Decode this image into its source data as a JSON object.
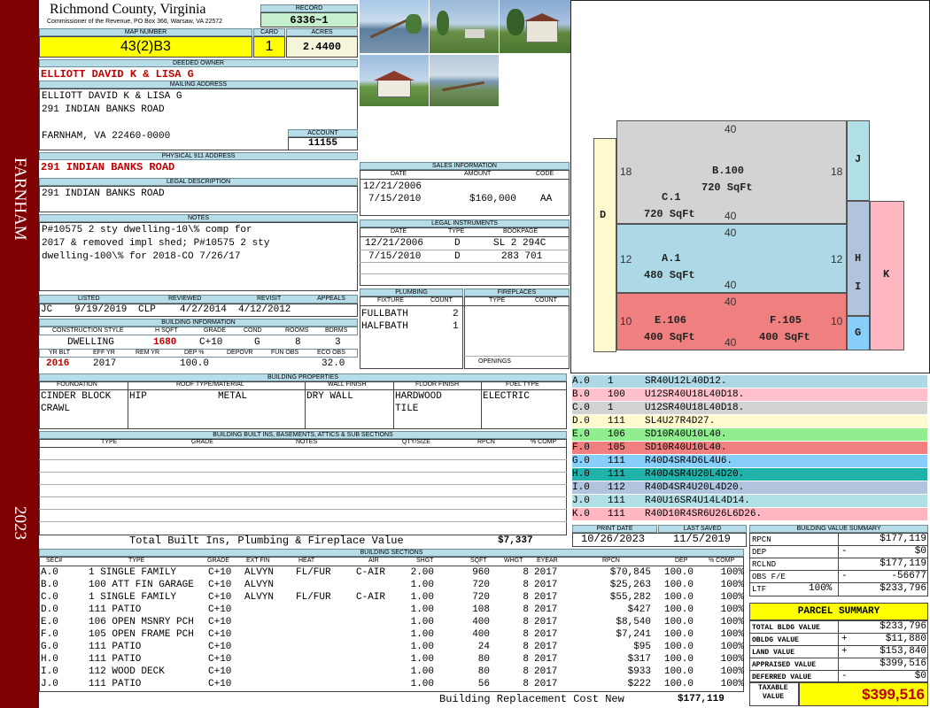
{
  "side": {
    "top": "FARNHAM",
    "bottom": "2023"
  },
  "header": {
    "county": "Richmond County, Virginia",
    "sub": "Commissioner of the Revenue, PO Box 366, Warsaw, VA 22572",
    "record_label": "RECORD",
    "record": "6336~1",
    "map_label": "MAP NUMBER",
    "map": "43(2)B3",
    "card_label": "CARD",
    "card": "1",
    "acres_label": "ACRES",
    "acres": "2.4400"
  },
  "owner": {
    "label": "DEEDED OWNER",
    "name": "ELLIOTT DAVID K & LISA G",
    "mail_label": "MAILING ADDRESS",
    "mail1": "ELLIOTT DAVID K & LISA G",
    "mail2": "291 INDIAN BANKS ROAD",
    "mail3": "FARNHAM, VA 22460-0000",
    "account_label": "ACCOUNT",
    "account": "11155"
  },
  "physical": {
    "label": "PHYSICAL 911 ADDRESS",
    "value": "291 INDIAN BANKS ROAD"
  },
  "legal": {
    "label": "LEGAL DESCRIPTION",
    "value": "291 INDIAN BANKS ROAD"
  },
  "notes": {
    "label": "NOTES",
    "l1": "P#10575 2 sty dwelling-10\\% comp for",
    "l2": "2017 & removed impl shed; P#10575 2 sty",
    "l3": "dwelling-100\\% for 2018-CO 7/26/17"
  },
  "sales": {
    "label": "SALES INFORMATION",
    "h": [
      "DATE",
      "AMOUNT",
      "CODE"
    ],
    "rows": [
      [
        "12/21/2006",
        "",
        ""
      ],
      [
        "7/15/2010",
        "$160,000",
        "AA"
      ]
    ]
  },
  "instruments": {
    "label": "LEGAL INSTRUMENTS",
    "h": [
      "DATE",
      "TYPE",
      "BOOKPAGE"
    ],
    "rows": [
      [
        "12/21/2006",
        "D",
        "SL 2 294C"
      ],
      [
        "7/15/2010",
        "D",
        "283 701"
      ]
    ]
  },
  "plumbing": {
    "label": "PLUMBING",
    "h": [
      "FIXTURE",
      "COUNT"
    ],
    "rows": [
      [
        "FULLBATH",
        "2"
      ],
      [
        "HALFBATH",
        "1"
      ]
    ]
  },
  "fireplaces": {
    "label": "FIREPLACES",
    "h": [
      "TYPE",
      "COUNT"
    ],
    "openings": "OPENINGS"
  },
  "listed": {
    "h": [
      "LISTED",
      "REVIEWED",
      "REVISIT",
      "APPEALS"
    ],
    "listed_by": "JC",
    "listed": "9/19/2019",
    "rev_by": "CLP",
    "reviewed": "4/2/2014",
    "revisit": "4/12/2012",
    "appeals": ""
  },
  "bldg": {
    "label": "BUILDING INFORMATION",
    "h1": [
      "CONSTRUCTION STYLE",
      "H SQFT",
      "GRADE",
      "COND",
      "ROOMS",
      "BDRMS"
    ],
    "style": "DWELLING",
    "hsqft": "1680",
    "grade": "C+10",
    "cond": "G",
    "rooms": "8",
    "bdrms": "3",
    "h2": [
      "YR BLT",
      "EFF YR",
      "REM YR",
      "DEP %",
      "DEPOVR",
      "FUN OBS",
      "ECO OBS"
    ],
    "yrblt": "2016",
    "effyr": "2017",
    "remyr": "",
    "dep": "100.0",
    "depovr": "",
    "funobs": "",
    "ecoobs": "32.0"
  },
  "props": {
    "label": "BUILDING PROPERTIES",
    "h": [
      "FOUNDATION",
      "ROOF TYPE/MATERIAL",
      "WALL FINISH",
      "FLOOR FINISH",
      "FUEL TYPE"
    ],
    "found1": "CINDER BLOCK",
    "found2": "CRAWL",
    "roof1": "HIP",
    "roof2": "METAL",
    "wall": "DRY WALL",
    "floor1": "HARDWOOD",
    "floor2": "TILE",
    "fuel": "ELECTRIC"
  },
  "builtins": {
    "label": "BUILDING BUILT INS, BASEMENTS, ATTICS & SUB SECTIONS",
    "h": [
      "TYPE",
      "GRADE",
      "NOTES",
      "QTY/SIZE",
      "RPCN",
      "% COMP"
    ],
    "total_label": "Total Built Ins, Plumbing & Fireplace Value",
    "total": "$7,337"
  },
  "sections": {
    "label": "BUILDING SECTIONS",
    "h": [
      "SEC#",
      "TYPE",
      "GRADE",
      "EXT FIN",
      "HEAT",
      "AIR",
      "SHGT",
      "SQFT",
      "WHGT",
      "EYEAR",
      "RPCN",
      "DEP",
      "% COMP"
    ],
    "rows": [
      [
        "A.0",
        "1 SINGLE FAMILY",
        "C+10",
        "ALVYN",
        "FL/FUR",
        "C-AIR",
        "2.00",
        "960",
        "8",
        "2017",
        "$70,845",
        "100.0",
        "100%"
      ],
      [
        "B.0",
        "100 ATT FIN GARAGE",
        "C+10",
        "ALVYN",
        "",
        "",
        "1.00",
        "720",
        "8",
        "2017",
        "$25,263",
        "100.0",
        "100%"
      ],
      [
        "C.0",
        "1 SINGLE FAMILY",
        "C+10",
        "ALVYN",
        "FL/FUR",
        "C-AIR",
        "1.00",
        "720",
        "8",
        "2017",
        "$55,282",
        "100.0",
        "100%"
      ],
      [
        "D.0",
        "111 PATIO",
        "C+10",
        "",
        "",
        "",
        "1.00",
        "108",
        "8",
        "2017",
        "$427",
        "100.0",
        "100%"
      ],
      [
        "E.0",
        "106 OPEN MSNRY PCH",
        "C+10",
        "",
        "",
        "",
        "1.00",
        "400",
        "8",
        "2017",
        "$8,540",
        "100.0",
        "100%"
      ],
      [
        "F.0",
        "105 OPEN FRAME PCH",
        "C+10",
        "",
        "",
        "",
        "1.00",
        "400",
        "8",
        "2017",
        "$7,241",
        "100.0",
        "100%"
      ],
      [
        "G.0",
        "111 PATIO",
        "C+10",
        "",
        "",
        "",
        "1.00",
        "24",
        "8",
        "2017",
        "$95",
        "100.0",
        "100%"
      ],
      [
        "H.0",
        "111 PATIO",
        "C+10",
        "",
        "",
        "",
        "1.00",
        "80",
        "8",
        "2017",
        "$317",
        "100.0",
        "100%"
      ],
      [
        "I.0",
        "112 WOOD DECK",
        "C+10",
        "",
        "",
        "",
        "1.00",
        "80",
        "8",
        "2017",
        "$933",
        "100.0",
        "100%"
      ],
      [
        "J.0",
        "111 PATIO",
        "C+10",
        "",
        "",
        "",
        "1.00",
        "56",
        "8",
        "2017",
        "$222",
        "100.0",
        "100%"
      ]
    ],
    "repl_label": "Building Replacement Cost New",
    "repl": "$177,119"
  },
  "sketch": {
    "A": "A.1",
    "Asq": "480 SqFt",
    "B": "B.100",
    "Bsq": "720 SqFt",
    "C": "C.1",
    "Csq": "720 SqFt",
    "D": "D",
    "E": "E.106",
    "Esq": "400 SqFt",
    "F": "F.105",
    "Fsq": "400 SqFt",
    "G": "G",
    "H": "H",
    "I": "I",
    "J": "J",
    "K": "K",
    "d40a": "40",
    "d40b": "40",
    "d40c": "40",
    "d40d": "40",
    "d40e": "40",
    "d40f": "40",
    "d18a": "18",
    "d18b": "18",
    "d12a": "12",
    "d12b": "12",
    "d10a": "10",
    "d10b": "10"
  },
  "legend": [
    {
      "sec": "A.0",
      "code": "1",
      "path": "SR40U12L40D12.",
      "color": "#add8e6"
    },
    {
      "sec": "B.0",
      "code": "100",
      "path": "U12SR40U18L40D18.",
      "color": "#ffc0cb"
    },
    {
      "sec": "C.0",
      "code": "1",
      "path": "U12SR40U18L40D18.",
      "color": "#d3d3d3"
    },
    {
      "sec": "D.0",
      "code": "111",
      "path": "SL4U27R4D27.",
      "color": "#fffacd"
    },
    {
      "sec": "E.0",
      "code": "106",
      "path": "SD10R40U10L40.",
      "color": "#90ee90"
    },
    {
      "sec": "F.0",
      "code": "105",
      "path": "SD10R40U10L40.",
      "color": "#f08080"
    },
    {
      "sec": "G.0",
      "code": "111",
      "path": "R40D4SR4D6L4U6.",
      "color": "#87cefa"
    },
    {
      "sec": "H.0",
      "code": "111",
      "path": "R40D4SR4U20L4D20.",
      "color": "#20b2aa"
    },
    {
      "sec": "I.0",
      "code": "112",
      "path": "R40D4SR4U20L4D20.",
      "color": "#b0c4de"
    },
    {
      "sec": "J.0",
      "code": "111",
      "path": "R40U16SR4U14L4D14.",
      "color": "#b0e0e6"
    },
    {
      "sec": "K.0",
      "code": "111",
      "path": "R40D10R4SR6U26L6D26.",
      "color": "#ffb6c1"
    }
  ],
  "print": {
    "pd_label": "PRINT DATE",
    "pd": "10/26/2023",
    "ls_label": "LAST SAVED",
    "ls": "11/5/2019"
  },
  "bvs": {
    "label": "BUILDING VALUE SUMMARY",
    "rpcn_l": "RPCN",
    "rpcn": "$177,119",
    "dep_l": "DEP",
    "dep_s": "-",
    "dep": "$0",
    "rclnd_l": "RCLND",
    "rclnd": "$177,119",
    "obs_l": "OBS F/E",
    "obs_s": "-",
    "obs": "-56677",
    "ltf_l": "LTF",
    "ltf_p": "100%",
    "ltf": "$233,796"
  },
  "parcel": {
    "label": "PARCEL SUMMARY",
    "tbv_l": "TOTAL BLDG VALUE",
    "tbv": "$233,796",
    "obldg_l": "OBLDG VALUE",
    "obldg_s": "+",
    "obldg": "$11,880",
    "land_l": "LAND VALUE",
    "land_s": "+",
    "land": "$153,840",
    "appr_l": "APPRAISED VALUE",
    "appr": "$399,516",
    "def_l": "DEFERRED VALUE",
    "def_s": "-",
    "def": "$0",
    "tax_l1": "TAXABLE",
    "tax_l2": "VALUE",
    "tax": "$399,516"
  }
}
